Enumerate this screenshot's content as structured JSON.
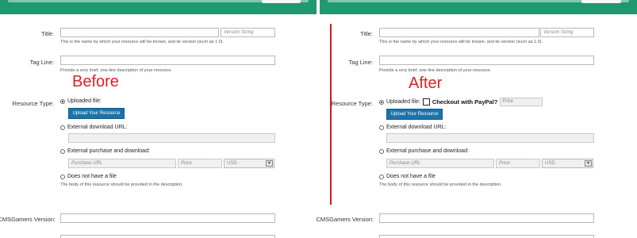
{
  "form": {
    "title_label": "Title:",
    "version_placeholder": "Version String",
    "title_hint": "This is the name by which your resource will be known, and its version (such as 1.0).",
    "tagline_label": "Tag Line:",
    "tagline_hint": "Provide a very brief, one-line description of your resource.",
    "resource_type_label": "Resource Type:",
    "uploaded_file": "Uploaded file:",
    "upload_button": "Upload Your Resource",
    "external_download": "External download URL:",
    "external_purchase": "External purchase and download:",
    "purchase_url_placeholder": "Purchase URL",
    "price_placeholder": "Price",
    "currency": "USD",
    "no_file": "Does not have a file",
    "no_file_hint": "The body of this resource should be provided in the description.",
    "cms_version_label": "CMSGamers Version:"
  },
  "annotations": {
    "before": "Before",
    "after": "After"
  },
  "after_extra": {
    "checkout_paypal": "Checkout with PayPal?",
    "price_placeholder": "Price"
  },
  "colors": {
    "header_green": "#1f9a6e",
    "button_blue": "#1c73a8",
    "annotation_red": "#e02020"
  }
}
